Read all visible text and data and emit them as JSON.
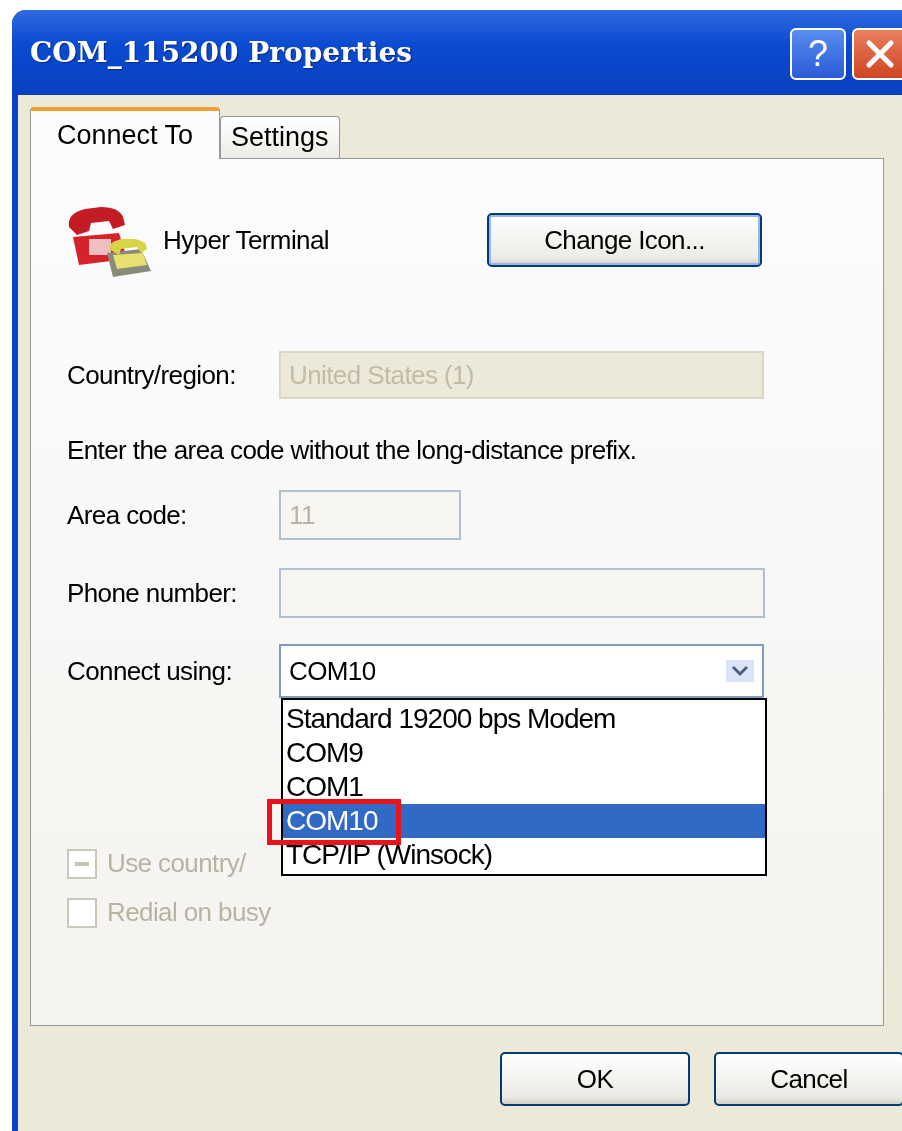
{
  "window": {
    "title": "COM_115200 Properties",
    "help_button": "?"
  },
  "tabs": [
    {
      "label": "Connect To",
      "selected": true
    },
    {
      "label": "Settings",
      "selected": false
    }
  ],
  "connection": {
    "name": "Hyper Terminal",
    "change_icon_button": "Change Icon..."
  },
  "country": {
    "label": "Country/region:",
    "value": "United States (1)",
    "disabled": true
  },
  "instruction": "Enter the area code without the long-distance prefix.",
  "area_code": {
    "label": "Area code:",
    "value": "11",
    "disabled": true
  },
  "phone_number": {
    "label": "Phone number:",
    "disabled": true
  },
  "connect_using": {
    "label": "Connect using:",
    "value": "COM10",
    "expanded": true,
    "options": [
      {
        "label": "Standard 19200 bps Modem",
        "selected": false,
        "highlighted": false
      },
      {
        "label": "COM9",
        "selected": false,
        "highlighted": false
      },
      {
        "label": "COM1",
        "selected": false,
        "highlighted": false
      },
      {
        "label": "COM10",
        "selected": true,
        "highlighted": true
      },
      {
        "label": "TCP/IP (Winsock)",
        "selected": false,
        "highlighted": false
      }
    ]
  },
  "checkboxes": [
    {
      "label": "Use country/",
      "checked": true,
      "disabled": true
    },
    {
      "label": "Redial on busy",
      "checked": false,
      "disabled": true
    }
  ],
  "buttons": [
    "OK",
    "Cancel"
  ]
}
